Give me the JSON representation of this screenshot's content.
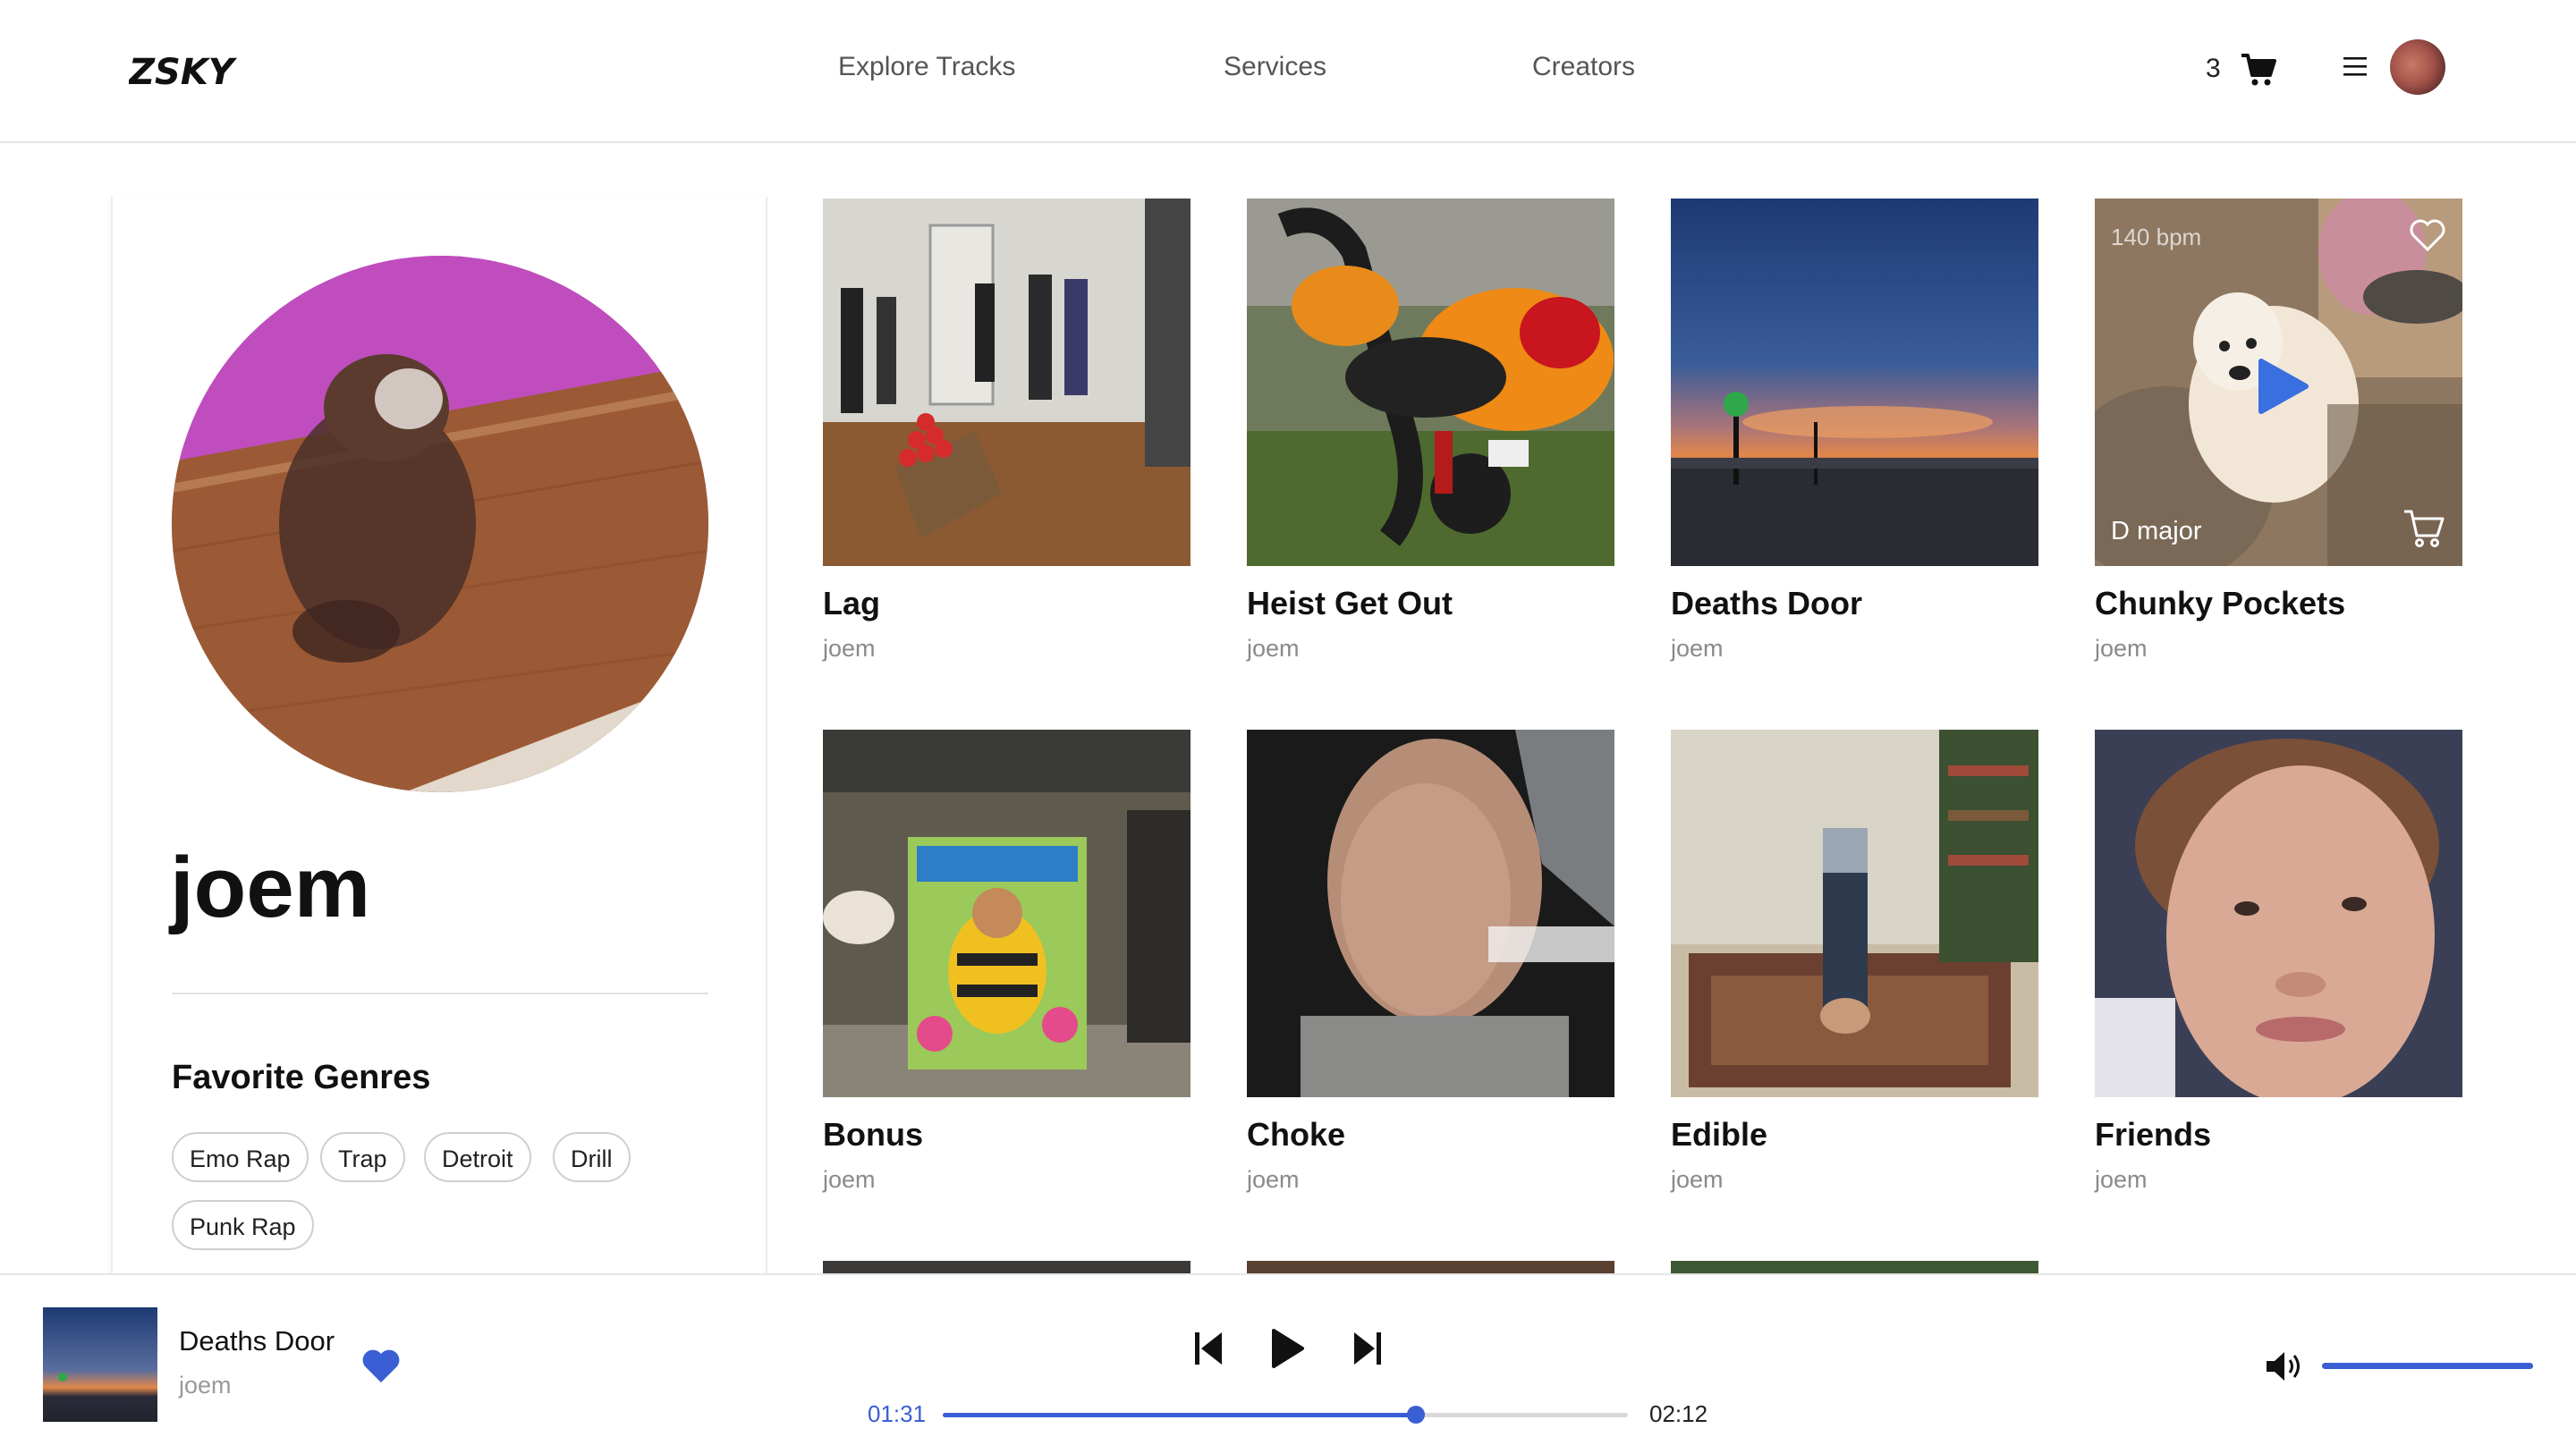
{
  "header": {
    "logo_text": "ZSKY",
    "nav": [
      "Explore Tracks",
      "Services",
      "Creators"
    ],
    "cart_count": "3",
    "icons": [
      "cart-icon",
      "menu-icon",
      "user-avatar"
    ]
  },
  "profile": {
    "username": "joem",
    "genres_title": "Favorite Genres",
    "genres": [
      "Emo Rap",
      "Trap",
      "Detroit",
      "Drill",
      "Punk Rap"
    ]
  },
  "tracks": [
    {
      "title": "Lag",
      "artist": "joem"
    },
    {
      "title": "Heist Get Out",
      "artist": "joem"
    },
    {
      "title": "Deaths Door",
      "artist": "joem"
    },
    {
      "title": "Chunky Pockets",
      "artist": "joem",
      "hover": {
        "key": "D major",
        "bpm": "140 bpm"
      }
    },
    {
      "title": "Bonus",
      "artist": "joem"
    },
    {
      "title": "Choke",
      "artist": "joem"
    },
    {
      "title": "Edible",
      "artist": "joem"
    },
    {
      "title": "Friends",
      "artist": "joem"
    }
  ],
  "player": {
    "title": "Deaths Door",
    "artist": "joem",
    "elapsed": "01:31",
    "duration": "02:12",
    "progress": 0.69,
    "volume": 1.0,
    "liked": true,
    "accent_color": "#3a5fd4"
  }
}
